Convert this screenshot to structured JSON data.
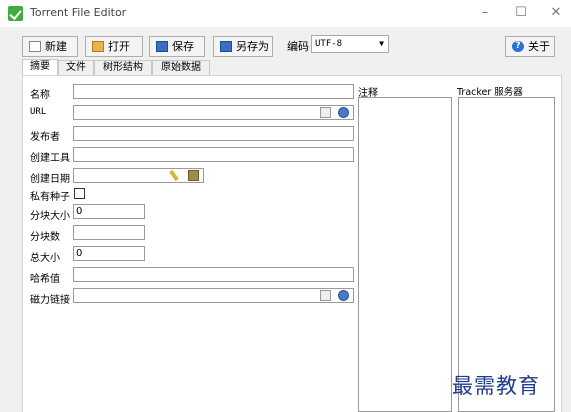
{
  "window": {
    "title": "Torrent File Editor",
    "minimize": "–",
    "maximize": "☐",
    "close": "✕"
  },
  "toolbar": {
    "new_label": "新建",
    "open_label": "打开",
    "save_label": "保存",
    "saveas_label": "另存为",
    "encoding_label": "编码",
    "encoding_value": "UTF-8",
    "about_label": "关于",
    "about_icon": "?"
  },
  "tabs": [
    "摘要",
    "文件",
    "树形结构",
    "原始数据"
  ],
  "form": {
    "name_label": "名称",
    "url_label": "URL",
    "publisher_label": "发布者",
    "created_by_label": "创建工具",
    "created_date_label": "创建日期",
    "private_label": "私有种子",
    "piece_size_label": "分块大小",
    "piece_size_value": "0",
    "piece_count_label": "分块数",
    "piece_count_value": "",
    "total_size_label": "总大小",
    "total_size_value": "0",
    "hash_label": "哈希值",
    "magnet_label": "磁力链接"
  },
  "comment": {
    "label": "注释"
  },
  "trackers": {
    "label": "Tracker 服务器"
  },
  "watermark": "最需教育"
}
